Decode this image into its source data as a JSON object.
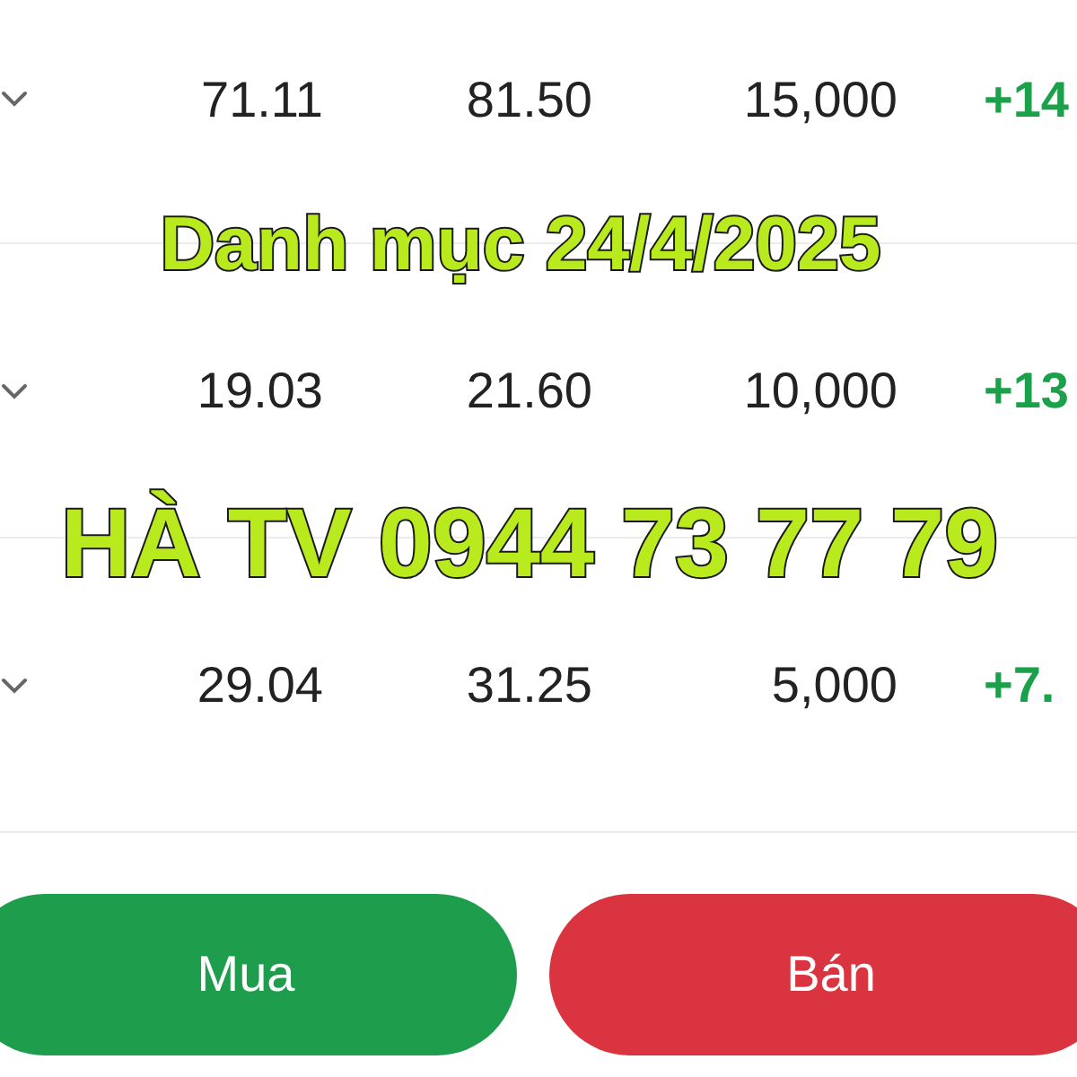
{
  "rows": [
    {
      "cost": "71.11",
      "price": "81.50",
      "quantity": "15,000",
      "change": "+14"
    },
    {
      "cost": "19.03",
      "price": "21.60",
      "quantity": "10,000",
      "change": "+13"
    },
    {
      "cost": "29.04",
      "price": "31.25",
      "quantity": "5,000",
      "change": "+7."
    }
  ],
  "buttons": [
    {
      "label": "Mua",
      "kind": "buy"
    },
    {
      "label": "Bán",
      "kind": "sell"
    }
  ],
  "captions": [
    "Danh mục 24/4/2025",
    "HÀ TV 0944 73 77 79"
  ]
}
